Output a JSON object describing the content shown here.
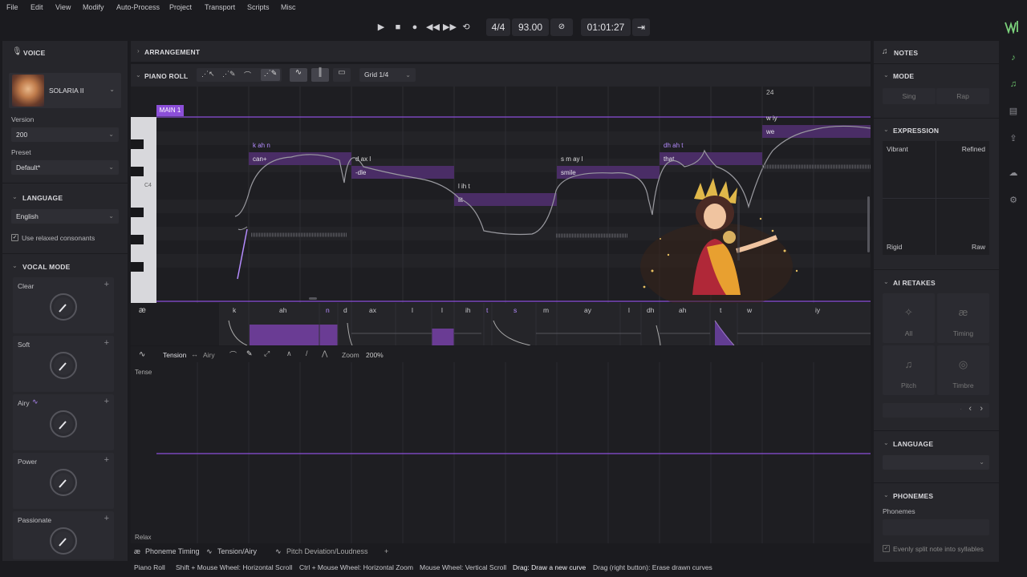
{
  "menu": [
    "File",
    "Edit",
    "View",
    "Modify",
    "Auto-Process",
    "Project",
    "Transport",
    "Scripts",
    "Misc"
  ],
  "transport": {
    "time_signature": "4/4",
    "tempo": "93.00",
    "position": "01:01:27"
  },
  "voice_panel": {
    "title": "VOICE",
    "voice_name": "SOLARIA II",
    "version_label": "Version",
    "version_value": "200",
    "preset_label": "Preset",
    "preset_value": "Default*",
    "language_title": "LANGUAGE",
    "language_value": "English",
    "relaxed_label": "Use relaxed consonants",
    "vocal_mode_title": "VOCAL MODE",
    "modes": [
      "Clear",
      "Soft",
      "Airy",
      "Power",
      "Passionate"
    ]
  },
  "arrangement_label": "ARRANGEMENT",
  "piano_roll": {
    "title": "PIANO ROLL",
    "grid": "Grid 1/4",
    "measure_number": "24",
    "track_label": "MAIN 1",
    "c4_label": "C4",
    "notes": [
      {
        "lyric": "can+",
        "phonemes": "k ah n"
      },
      {
        "lyric": "-dle",
        "phonemes": "d ax l"
      },
      {
        "lyric": "lit",
        "phonemes": "l ih t"
      },
      {
        "lyric": "smile",
        "phonemes": "s m ay l"
      },
      {
        "lyric": "that",
        "phonemes": "dh ah t"
      },
      {
        "lyric": "we",
        "phonemes": "w iy"
      }
    ],
    "phoneme_symbol": "æ",
    "phoneme_row": [
      "k",
      "ah",
      "n",
      "d",
      "ax",
      "l",
      "l",
      "ih",
      "t",
      "s",
      "m",
      "ay",
      "l",
      "dh",
      "ah",
      "t",
      "w",
      "iy"
    ]
  },
  "param_lane": {
    "param": "Tension",
    "param_alt": "Airy",
    "arrow": "↔",
    "zoom_label": "Zoom",
    "zoom_value": "200%",
    "top_label": "Tense",
    "bottom_label": "Relax"
  },
  "bottom_tabs": [
    "Phoneme Timing",
    "Tension/Airy",
    "Pitch Deviation/Loudness",
    "+"
  ],
  "status": [
    {
      "label": "Piano Roll"
    },
    {
      "label": "Shift + Mouse Wheel: Horizontal Scroll"
    },
    {
      "label": "Ctrl + Mouse Wheel: Horizontal Zoom"
    },
    {
      "label": "Mouse Wheel: Vertical Scroll"
    },
    {
      "label": "Drag: Draw a new curve"
    },
    {
      "label": "Drag (right button): Erase drawn curves"
    }
  ],
  "notes_panel": {
    "title": "NOTES",
    "mode_title": "MODE",
    "mode_sing": "Sing",
    "mode_rap": "Rap",
    "expression_title": "EXPRESSION",
    "expr_tl": "Vibrant",
    "expr_tr": "Refined",
    "expr_bl": "Rigid",
    "expr_br": "Raw",
    "retakes_title": "AI RETAKES",
    "retakes": [
      "All",
      "Timing",
      "Pitch",
      "Timbre"
    ],
    "language_title": "LANGUAGE",
    "phonemes_title": "PHONEMES",
    "phonemes_label": "Phonemes",
    "split_label": "Evenly split note into syllables"
  },
  "colors": {
    "accent": "#8c4fd9",
    "accent_light": "#b58cff",
    "bg": "#1b1b1f",
    "panel": "#26262b",
    "note": "#4a2d66"
  }
}
